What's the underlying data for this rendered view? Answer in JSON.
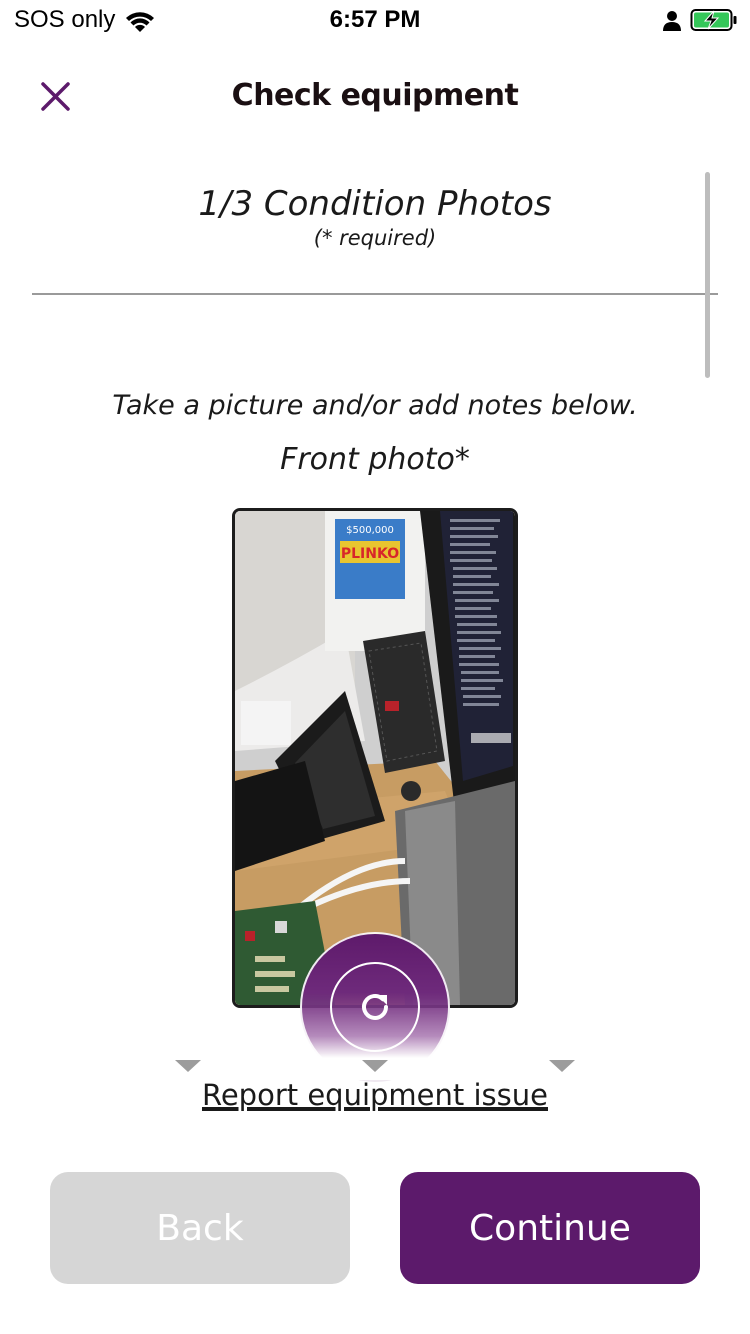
{
  "status_bar": {
    "carrier": "SOS only",
    "time": "6:57 PM",
    "icons": [
      "wifi-icon",
      "person-icon",
      "battery-charging-icon"
    ]
  },
  "header": {
    "title": "Check equipment",
    "close_icon": "close-icon"
  },
  "section": {
    "title": "1/3 Condition Photos",
    "required_note": "(* required)"
  },
  "content": {
    "instructions": "Take a picture and/or add notes below.",
    "photo_label": "Front photo*",
    "retake_icon": "refresh-icon",
    "photo_sign_text": "PLINKO",
    "photo_sign_prize": "$500,000"
  },
  "carousel": {
    "indicator_count": 3,
    "active_index": 1
  },
  "links": {
    "report_issue": "Report equipment issue"
  },
  "footer": {
    "back_label": "Back",
    "continue_label": "Continue"
  },
  "colors": {
    "accent": "#5c1a6b",
    "disabled_button": "#d6d6d6",
    "text": "#1a1a1a",
    "divider": "#9a9a9a"
  }
}
